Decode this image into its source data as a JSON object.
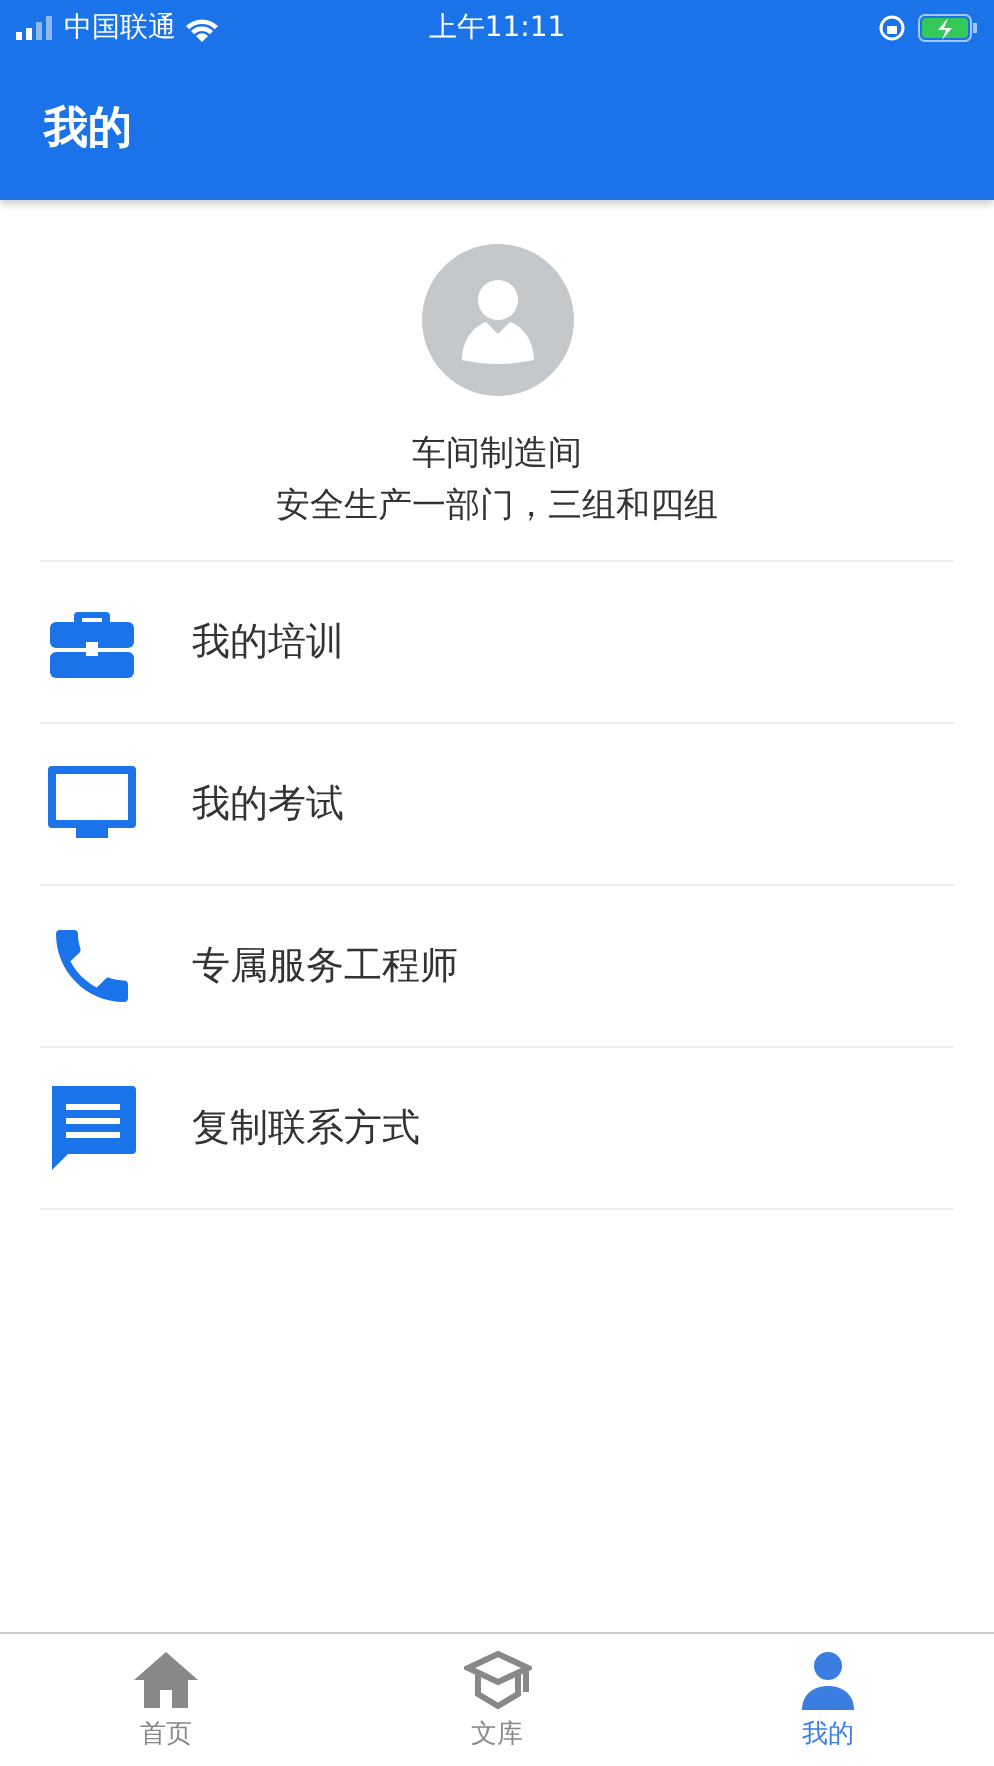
{
  "status_bar": {
    "carrier": "中国联通",
    "time": "上午11:11"
  },
  "header": {
    "title": "我的"
  },
  "profile": {
    "name": "车间制造间",
    "department": "安全生产一部门，三组和四组"
  },
  "menu": [
    {
      "kind": "briefcase",
      "label": "我的培训"
    },
    {
      "kind": "monitor",
      "label": "我的考试"
    },
    {
      "kind": "phone",
      "label": "专属服务工程师"
    },
    {
      "kind": "message",
      "label": "复制联系方式"
    }
  ],
  "tabs": [
    {
      "kind": "home",
      "label": "首页",
      "selected": false
    },
    {
      "kind": "library",
      "label": "文库",
      "selected": false
    },
    {
      "kind": "person",
      "label": "我的",
      "selected": true
    }
  ]
}
